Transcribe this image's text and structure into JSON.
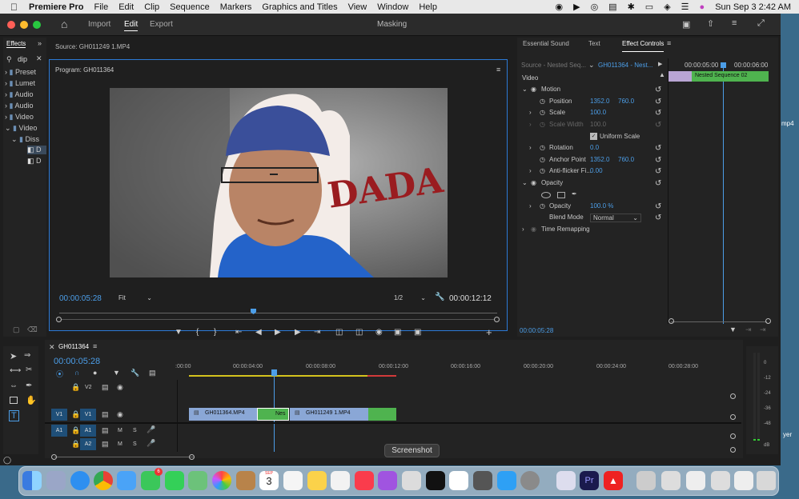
{
  "menubar": {
    "app": "Premiere Pro",
    "items": [
      "File",
      "Edit",
      "Clip",
      "Sequence",
      "Markers",
      "Graphics and Titles",
      "View",
      "Window",
      "Help"
    ],
    "clock": "Sun Sep 3  2:42 AM"
  },
  "titlebar": {
    "tabs": [
      "Import",
      "Edit",
      "Export"
    ],
    "active": "Edit",
    "title": "Masking"
  },
  "effects": {
    "tab": "Effects",
    "search": "dip",
    "tree": [
      "Preset",
      "Lumet",
      "Audio",
      "Audio",
      "Video",
      "Video",
      "Diss",
      "D",
      "D"
    ]
  },
  "source": {
    "label": "Source: GH011249 1.MP4"
  },
  "program": {
    "label": "Program: GH011364",
    "timecode": "00:00:05:28",
    "fit": "Fit",
    "resolution": "1/2",
    "duration": "00:00:12:12",
    "overlay_text": "DADA"
  },
  "ec": {
    "tabs": [
      "Essential Sound",
      "Text",
      "Effect Controls"
    ],
    "source": "Source - Nested Seq...",
    "target": "GH011364 - Nest...",
    "t1": "00:00:05:00",
    "t2": "00:00:06:00",
    "clip": "Nested Sequence 02",
    "rows": {
      "video": "Video",
      "motion": "Motion",
      "position": "Position",
      "pos_x": "1352.0",
      "pos_y": "760.0",
      "scale": "Scale",
      "scale_v": "100.0",
      "scale_w": "Scale Width",
      "scale_w_v": "100.0",
      "uniform": "Uniform Scale",
      "rotation": "Rotation",
      "rot_v": "0.0",
      "anchor": "Anchor Point",
      "anc_x": "1352.0",
      "anc_y": "760.0",
      "flicker": "Anti-flicker Fi...",
      "flicker_v": "0.00",
      "opacity": "Opacity",
      "opacity_p": "Opacity",
      "opacity_v": "100.0 %",
      "blend": "Blend Mode",
      "blend_v": "Normal",
      "time": "Time Remapping"
    },
    "timecode": "00:00:05:28"
  },
  "timeline": {
    "tab": "GH011364",
    "timecode": "00:00:05:28",
    "ruler": [
      ":00:00",
      "00:00:04:00",
      "00:00:08:00",
      "00:00:12:00",
      "00:00:16:00",
      "00:00:20:00",
      "00:00:24:00",
      "00:00:28:00"
    ],
    "tracks": [
      "V2",
      "V1",
      "A1",
      "A2"
    ],
    "src_v1": "V1",
    "src_a1": "A1",
    "m": "M",
    "s": "S",
    "clips": [
      "GH011364.MP4",
      "Nes",
      "GH011249 1.MP4"
    ]
  },
  "meter": [
    "0",
    "-12",
    "-24",
    "-36",
    "-48",
    "dB"
  ],
  "tooltip": "Screenshot",
  "desktop": {
    "a": "mp4",
    "b": "yer"
  },
  "dock": {
    "calendar_month": "SEP",
    "calendar_day": "3",
    "badge": "6"
  }
}
